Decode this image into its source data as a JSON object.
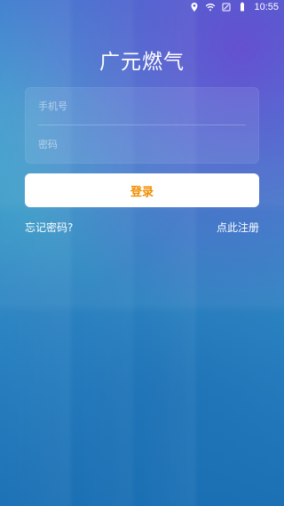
{
  "status_bar": {
    "time": "10:55",
    "icons": [
      "location-icon",
      "wifi-icon",
      "signal-off-icon",
      "battery-icon"
    ]
  },
  "app": {
    "title": "广元燃气"
  },
  "login_form": {
    "phone_placeholder": "手机号",
    "password_placeholder": "密码",
    "login_label": "登录",
    "forgot_password_label": "忘记密码?",
    "register_label": "点此注册"
  },
  "colors": {
    "accent": "#ef8d00",
    "text": "#ffffff",
    "button_bg": "#ffffff"
  }
}
